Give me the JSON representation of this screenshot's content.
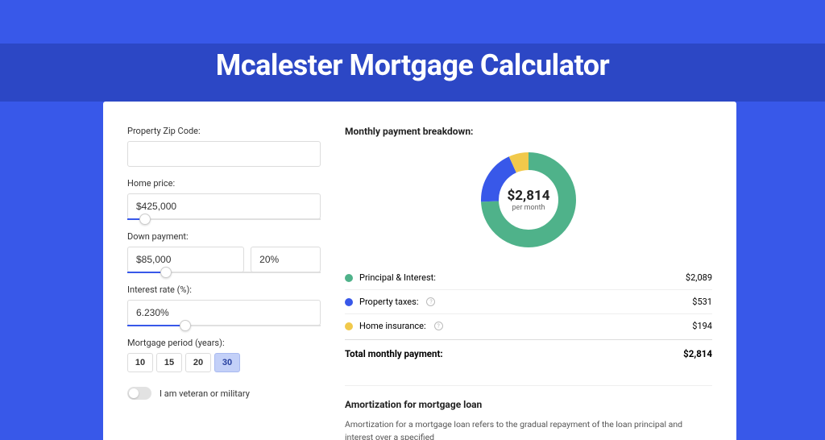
{
  "title": "Mcalester Mortgage Calculator",
  "form": {
    "zip_label": "Property Zip Code:",
    "zip_value": "",
    "price_label": "Home price:",
    "price_value": "$425,000",
    "price_slider_pct": 9,
    "down_label": "Down payment:",
    "down_value": "$85,000",
    "down_pct_value": "20%",
    "down_slider_pct": 20,
    "rate_label": "Interest rate (%):",
    "rate_value": "6.230%",
    "rate_slider_pct": 30,
    "period_label": "Mortgage period (years):",
    "period_options": [
      "10",
      "15",
      "20",
      "30"
    ],
    "period_selected": "30",
    "veteran_label": "I am veteran or military"
  },
  "breakdown": {
    "title": "Monthly payment breakdown:",
    "donut_value": "$2,814",
    "donut_sub": "per month",
    "total_label": "Total monthly payment:",
    "total_value": "$2,814",
    "items": [
      {
        "label": "Principal & Interest:",
        "value": "$2,089",
        "color": "#4fb28a",
        "info": false
      },
      {
        "label": "Property taxes:",
        "value": "$531",
        "color": "#3858e9",
        "info": true
      },
      {
        "label": "Home insurance:",
        "value": "$194",
        "color": "#f1c94b",
        "info": true
      }
    ]
  },
  "chart_data": {
    "type": "pie",
    "title": "Monthly payment breakdown",
    "series": [
      {
        "name": "Principal & Interest",
        "value": 2089,
        "color": "#4fb28a"
      },
      {
        "name": "Property taxes",
        "value": 531,
        "color": "#3858e9"
      },
      {
        "name": "Home insurance",
        "value": 194,
        "color": "#f1c94b"
      }
    ],
    "total": 2814,
    "center_label": "$2,814 per month"
  },
  "amortization": {
    "title": "Amortization for mortgage loan",
    "text": "Amortization for a mortgage loan refers to the gradual repayment of the loan principal and interest over a specified"
  }
}
